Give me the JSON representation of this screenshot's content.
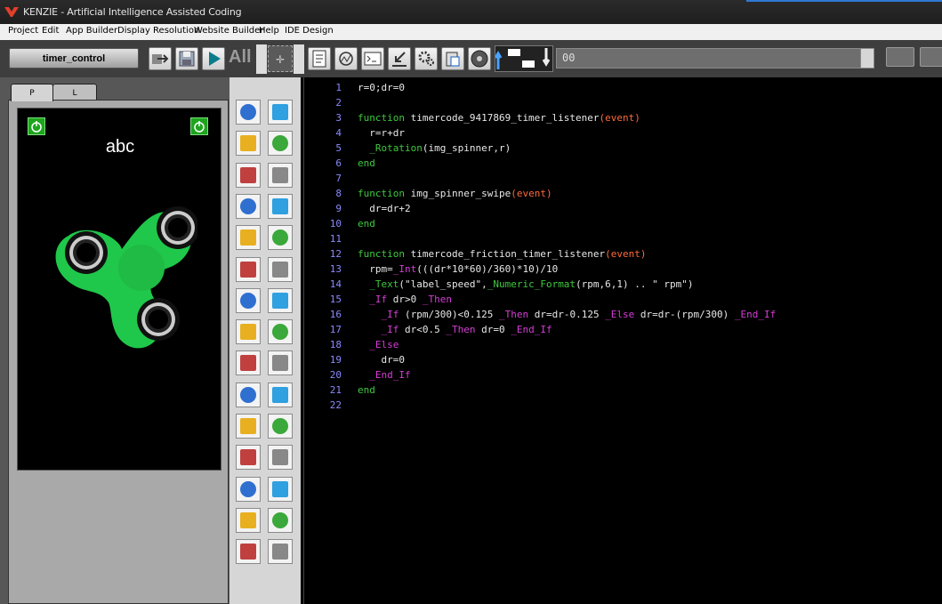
{
  "window": {
    "title": "KENZIE - Artificial Intelligence Assisted Coding"
  },
  "menu": [
    "Project",
    "Edit",
    "App Builder",
    "Display Resolution",
    "Website Builder",
    "Help",
    "IDE Design"
  ],
  "toolbar": {
    "form_name": "timer_control",
    "all_label": "All",
    "combo_value": "00"
  },
  "tabs": {
    "portrait": "P",
    "landscape": "L"
  },
  "phone": {
    "label": "abc",
    "spinner_color": "#1fc84a"
  },
  "toolbox_icons": [
    "textbox-icon",
    "text-label-icon",
    "image-icon",
    "button-icon",
    "image-button-icon",
    "shape-icon",
    "grid-icon",
    "custom-control-icon",
    "progress-icon",
    "container-icon",
    "listbox-icon",
    "layout-icon",
    "input-icon",
    "path-icon",
    "slider-icon",
    "flow-icon",
    "spinner-dots-icon",
    "resize-icon",
    "numeric-stepper-icon",
    "draw-icon",
    "toggle-icon",
    "pen-icon",
    "html-icon",
    "web-icon",
    "map-icon",
    "document-icon",
    "radio-icon",
    "timer-icon",
    "checkbox-icon",
    "media-icon"
  ],
  "editor": {
    "lines": [
      {
        "n": "1",
        "t": [
          [
            "sym",
            "r=0;dr=0"
          ]
        ]
      },
      {
        "n": "2",
        "t": []
      },
      {
        "n": "3",
        "t": [
          [
            "kw",
            "function "
          ],
          [
            "sym",
            "timercode_9417869_timer_listener"
          ],
          [
            "fn",
            "(event)"
          ]
        ]
      },
      {
        "n": "4",
        "t": [
          [
            "sym",
            "  r=r+dr"
          ]
        ]
      },
      {
        "n": "5",
        "t": [
          [
            "sym",
            "  "
          ],
          [
            "kw",
            "_Rotation"
          ],
          [
            "sym",
            "(img_spinner,r)"
          ]
        ]
      },
      {
        "n": "6",
        "t": [
          [
            "kw",
            "end"
          ]
        ]
      },
      {
        "n": "7",
        "t": []
      },
      {
        "n": "8",
        "t": [
          [
            "kw",
            "function "
          ],
          [
            "sym",
            "img_spinner_swipe"
          ],
          [
            "fn",
            "(event)"
          ]
        ]
      },
      {
        "n": "9",
        "t": [
          [
            "sym",
            "  dr=dr+2"
          ]
        ]
      },
      {
        "n": "10",
        "t": [
          [
            "kw",
            "end"
          ]
        ]
      },
      {
        "n": "11",
        "t": []
      },
      {
        "n": "12",
        "t": [
          [
            "kw",
            "function "
          ],
          [
            "sym",
            "timercode_friction_timer_listener"
          ],
          [
            "fn",
            "(event)"
          ]
        ]
      },
      {
        "n": "13",
        "t": [
          [
            "sym",
            "  rpm="
          ],
          [
            "bi",
            "_Int"
          ],
          [
            "sym",
            "(((dr*10*60)/360)*10)/10"
          ]
        ]
      },
      {
        "n": "14",
        "t": [
          [
            "sym",
            "  "
          ],
          [
            "kw",
            "_Text"
          ],
          [
            "sym",
            "(\"label_speed\","
          ],
          [
            "kw",
            "_Numeric_Format"
          ],
          [
            "sym",
            "(rpm,6,1) .. \" rpm\")"
          ]
        ]
      },
      {
        "n": "15",
        "t": [
          [
            "sym",
            "  "
          ],
          [
            "bi",
            "_If"
          ],
          [
            "sym",
            " dr>0 "
          ],
          [
            "bi",
            "_Then"
          ]
        ]
      },
      {
        "n": "16",
        "t": [
          [
            "sym",
            "    "
          ],
          [
            "bi",
            "_If"
          ],
          [
            "sym",
            " (rpm/300)<0.125 "
          ],
          [
            "bi",
            "_Then"
          ],
          [
            "sym",
            " dr=dr-0.125 "
          ],
          [
            "bi",
            "_Else"
          ],
          [
            "sym",
            " dr=dr-(rpm/300) "
          ],
          [
            "bi",
            "_End_If"
          ]
        ]
      },
      {
        "n": "17",
        "t": [
          [
            "sym",
            "    "
          ],
          [
            "bi",
            "_If"
          ],
          [
            "sym",
            " dr<0.5 "
          ],
          [
            "bi",
            "_Then"
          ],
          [
            "sym",
            " dr=0 "
          ],
          [
            "bi",
            "_End_If"
          ]
        ]
      },
      {
        "n": "18",
        "t": [
          [
            "sym",
            "  "
          ],
          [
            "bi",
            "_Else"
          ]
        ]
      },
      {
        "n": "19",
        "t": [
          [
            "sym",
            "    dr=0"
          ]
        ]
      },
      {
        "n": "20",
        "t": [
          [
            "sym",
            "  "
          ],
          [
            "bi",
            "_End_If"
          ]
        ]
      },
      {
        "n": "21",
        "t": [
          [
            "kw",
            "end"
          ]
        ]
      },
      {
        "n": "22",
        "t": []
      }
    ]
  }
}
